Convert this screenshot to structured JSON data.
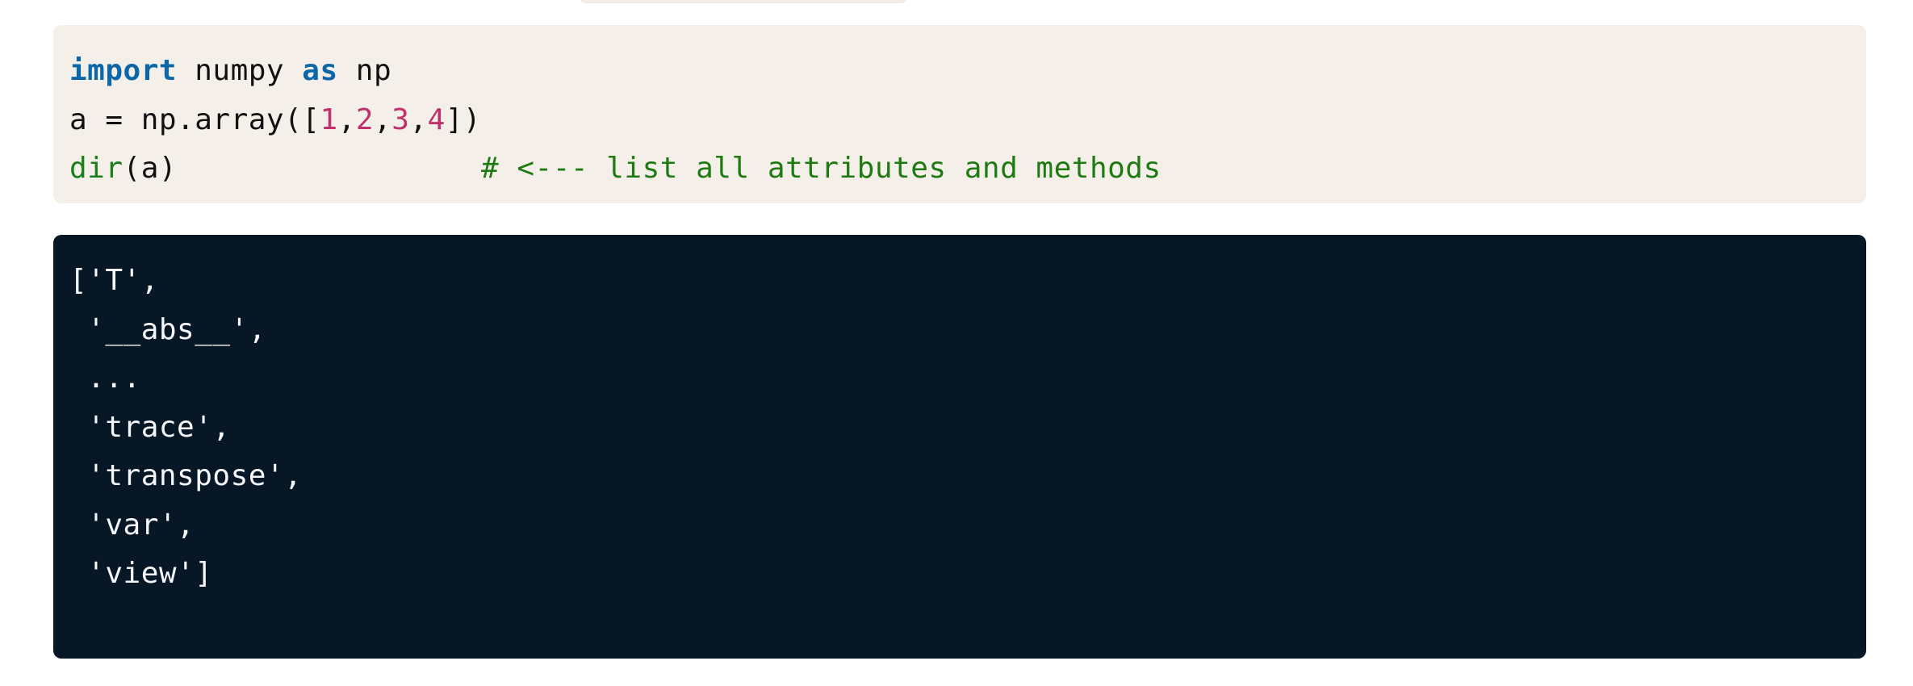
{
  "code": {
    "line1": {
      "kw_import": "import",
      "t1": " numpy ",
      "kw_as": "as",
      "t2": " np"
    },
    "line2": {
      "t1": "a = np.array([",
      "n1": "1",
      "c1": ",",
      "n2": "2",
      "c2": ",",
      "n3": "3",
      "c3": ",",
      "n4": "4",
      "t2": "])"
    },
    "line3": {
      "fn": "dir",
      "t1": "(a)",
      "spacer": "                 ",
      "comment": "# <--- list all attributes and methods"
    }
  },
  "output": {
    "lines": [
      "['T',",
      " '__abs__',",
      " ...",
      " 'trace',",
      " 'transpose',",
      " 'var',",
      " 'view']"
    ]
  },
  "colors": {
    "code_bg": "#f4efe8",
    "output_bg": "#071726",
    "keyword": "#0b67a8",
    "number": "#c0306b",
    "builtin": "#1a7f1a",
    "comment": "#1f7a12"
  }
}
